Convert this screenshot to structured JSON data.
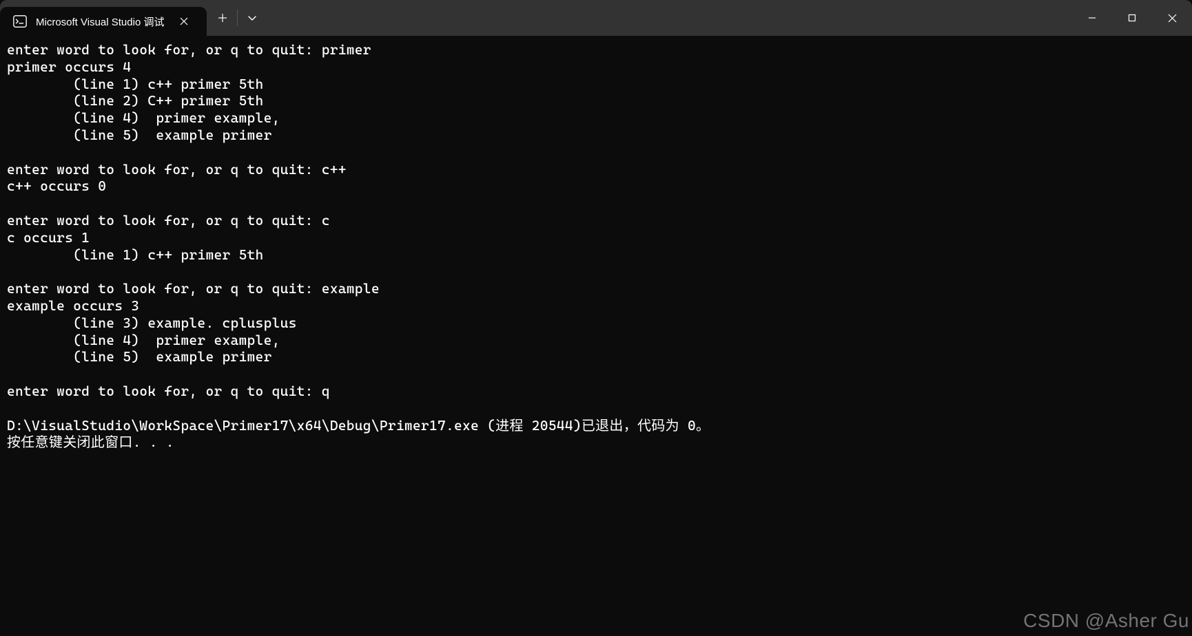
{
  "titlebar": {
    "tab_title": "Microsoft Visual Studio 调试",
    "tab_icon_name": "terminal-icon",
    "close_label": "✕",
    "new_tab_label": "＋",
    "dropdown_label": "⌄",
    "minimize_label": "—",
    "maximize_label": "☐",
    "window_close_label": "✕"
  },
  "console": {
    "lines": [
      "enter word to look for, or q to quit: primer",
      "primer occurs 4",
      "        (line 1) c++ primer 5th",
      "        (line 2) C++ primer 5th",
      "        (line 4)  primer example,",
      "        (line 5)  example primer",
      "",
      "enter word to look for, or q to quit: c++",
      "c++ occurs 0",
      "",
      "enter word to look for, or q to quit: c",
      "c occurs 1",
      "        (line 1) c++ primer 5th",
      "",
      "enter word to look for, or q to quit: example",
      "example occurs 3",
      "        (line 3) example. cplusplus",
      "        (line 4)  primer example,",
      "        (line 5)  example primer",
      "",
      "enter word to look for, or q to quit: q",
      "",
      "D:\\VisualStudio\\WorkSpace\\Primer17\\x64\\Debug\\Primer17.exe (进程 20544)已退出，代码为 0。",
      "按任意键关闭此窗口. . ."
    ]
  },
  "watermark": "CSDN @Asher Gu"
}
